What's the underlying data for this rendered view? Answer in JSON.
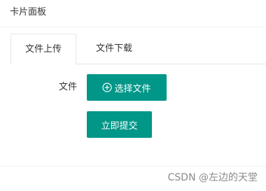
{
  "card": {
    "title": "卡片面板"
  },
  "tabs": [
    {
      "label": "文件上传",
      "active": true
    },
    {
      "label": "文件下载",
      "active": false
    }
  ],
  "form": {
    "file_label": "文件",
    "select_button_label": "选择文件",
    "select_button_icon": "plus-circle-icon",
    "submit_button_label": "立即提交"
  },
  "colors": {
    "primary": "#009688",
    "border": "#e6e6e6",
    "text": "#333333"
  },
  "watermark": {
    "text": "CSDN @左边的天堂"
  }
}
